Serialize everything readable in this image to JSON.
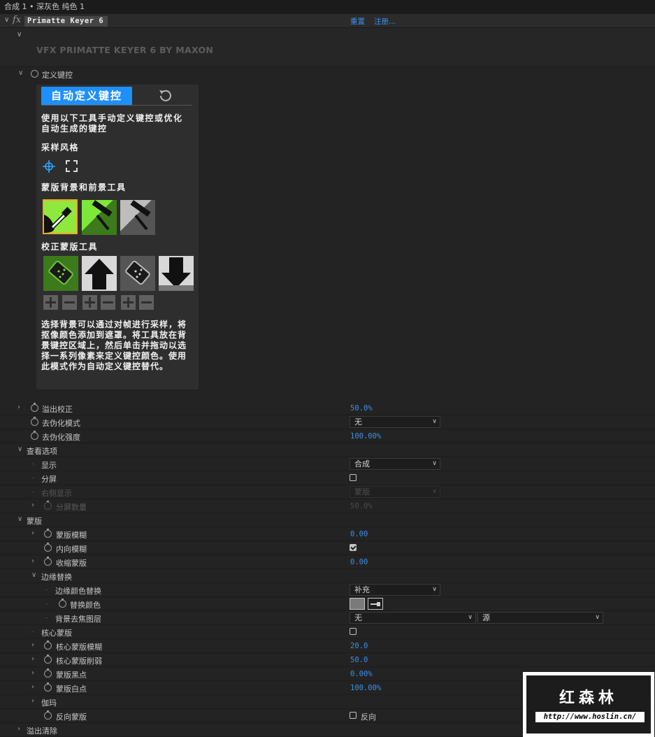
{
  "header": {
    "breadcrumb": "合成 1 • 深灰色 纯色 1"
  },
  "effect": {
    "name": "Primatte Keyer 6",
    "reset": "重置",
    "register": "注册...",
    "banner": "VFX PRIMATTE KEYER 6 BY MAXON"
  },
  "define_key": {
    "label": "定义键控",
    "tab": "自动定义键控",
    "intro": [
      "使用以下工具手动定义键控或优化",
      "自动生成的键控"
    ],
    "sampling_title": "采样风格",
    "matte_tools_title": "蒙版背景和前景工具",
    "correct_tools_title": "校正蒙版工具",
    "description": [
      "选择背景可以通过对帧进行采样，将",
      "抠像颜色添加到遮罩。将工具放在背",
      "景键控区域上，然后单击并拖动以选",
      "择一系列像素来定义键控颜色。使用",
      "此模式作为自动定义键控替代。"
    ]
  },
  "rows": {
    "spill": {
      "label": "溢出校正",
      "value": "50.0%"
    },
    "deartifact_mode": {
      "label": "去伪化模式",
      "value": "无"
    },
    "deartifact_strength": {
      "label": "去伪化强度",
      "value": "100.00%"
    },
    "view_options": {
      "label": "查看选项"
    },
    "display": {
      "label": "显示",
      "value": "合成"
    },
    "split": {
      "label": "分屏"
    },
    "right_display": {
      "label": "右侧显示",
      "value": "蒙版"
    },
    "split_amount": {
      "label": "分屏数量",
      "value": "50.0%"
    },
    "matte": {
      "label": "蒙版"
    },
    "matte_blur": {
      "label": "蒙版模糊",
      "value": "0.00"
    },
    "inner_blur": {
      "label": "内向模糊"
    },
    "shrink_matte": {
      "label": "收缩蒙版",
      "value": "0.00"
    },
    "edge_replace": {
      "label": "边缘替换"
    },
    "edge_color_replace": {
      "label": "边缘颜色替换",
      "value": "补充"
    },
    "replace_color": {
      "label": "替换颜色"
    },
    "bg_defocus": {
      "label": "背景去焦图层",
      "value": "无",
      "value2": "源"
    },
    "core_matte": {
      "label": "核心蒙版"
    },
    "core_matte_blur": {
      "label": "核心蒙版模糊",
      "value": "20.0"
    },
    "core_matte_erode": {
      "label": "核心蒙版削弱",
      "value": "50.0"
    },
    "matte_black": {
      "label": "蒙版黑点",
      "value": "0.00%"
    },
    "matte_white": {
      "label": "蒙版白点",
      "value": "100.00%"
    },
    "gamma": {
      "label": "伽玛"
    },
    "invert_matte": {
      "label": "反向蒙版",
      "check_label": "反向"
    },
    "spill_cleanup": {
      "label": "溢出清除"
    }
  },
  "watermark": {
    "title": "红森林",
    "url": "http://www.hoslin.cn/"
  },
  "colors": {
    "accent": "#1e8fff",
    "link": "#3e8ee6",
    "bg": "#232323",
    "tool_green": "#7ee83a"
  }
}
